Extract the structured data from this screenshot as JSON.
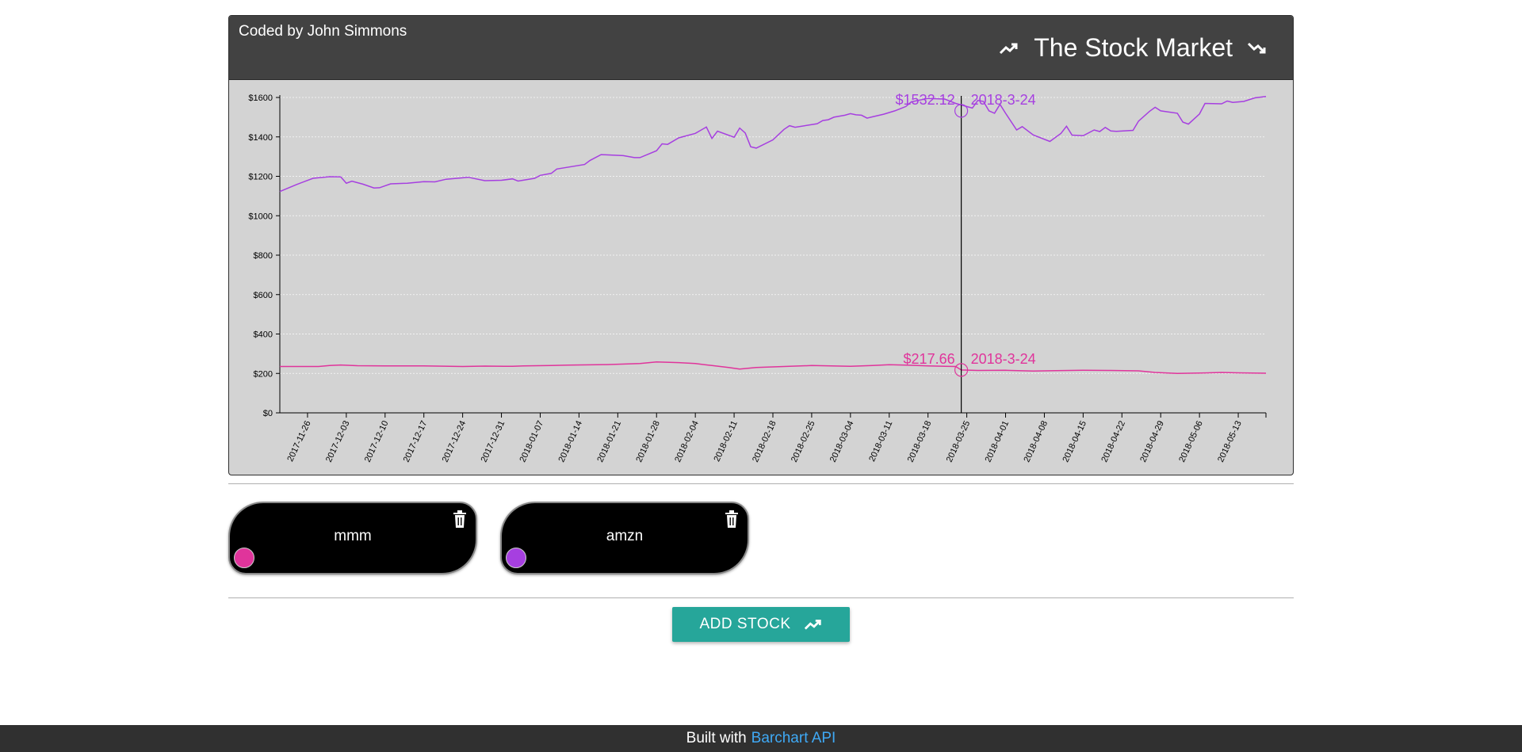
{
  "header": {
    "credit": "Coded by John Simmons",
    "title": "The Stock Market",
    "icon_left": "trending-up-icon",
    "icon_right": "trending-down-icon"
  },
  "colors": {
    "amzn": "#a63fe0",
    "mmm": "#e0349b",
    "header_bg": "#424242",
    "chart_bg": "#d3d3d3",
    "button": "#26a69a",
    "link": "#3fa9f5"
  },
  "stocks": [
    {
      "symbol": "mmm",
      "color": "#e0349b"
    },
    {
      "symbol": "amzn",
      "color": "#a63fe0"
    }
  ],
  "button": {
    "label": "ADD STOCK",
    "icon": "trending-up-icon"
  },
  "footer": {
    "prefix": "Built with",
    "link": "Barchart API"
  },
  "chart_data": {
    "type": "line",
    "title": "",
    "xlabel": "",
    "ylabel": "",
    "x_start": "2017-11-21",
    "x_end": "2018-05-18",
    "ylim": [
      0,
      1600
    ],
    "yticks": [
      {
        "value": 0,
        "label": "$0"
      },
      {
        "value": 200,
        "label": "$200"
      },
      {
        "value": 400,
        "label": "$400"
      },
      {
        "value": 600,
        "label": "$600"
      },
      {
        "value": 800,
        "label": "$800"
      },
      {
        "value": 1000,
        "label": "$1000"
      },
      {
        "value": 1200,
        "label": "$1200"
      },
      {
        "value": 1400,
        "label": "$1400"
      },
      {
        "value": 1600,
        "label": "$1600"
      }
    ],
    "xticks": [
      "2017-11-26",
      "2017-12-03",
      "2017-12-10",
      "2017-12-17",
      "2017-12-24",
      "2017-12-31",
      "2018-01-07",
      "2018-01-14",
      "2018-01-21",
      "2018-01-28",
      "2018-02-04",
      "2018-02-11",
      "2018-02-18",
      "2018-02-25",
      "2018-03-04",
      "2018-03-11",
      "2018-03-18",
      "2018-03-25",
      "2018-04-01",
      "2018-04-08",
      "2018-04-15",
      "2018-04-22",
      "2018-04-29",
      "2018-05-06",
      "2018-05-13"
    ],
    "grid": true,
    "series": [
      {
        "name": "amzn",
        "color": "#a63fe0",
        "points": [
          [
            "2017-11-21",
            1123
          ],
          [
            "2017-11-24",
            1158
          ],
          [
            "2017-11-27",
            1190
          ],
          [
            "2017-11-30",
            1198
          ],
          [
            "2017-12-02",
            1197
          ],
          [
            "2017-12-03",
            1165
          ],
          [
            "2017-12-04",
            1175
          ],
          [
            "2017-12-06",
            1160
          ],
          [
            "2017-12-08",
            1141
          ],
          [
            "2017-12-09",
            1142
          ],
          [
            "2017-12-11",
            1162
          ],
          [
            "2017-12-14",
            1165
          ],
          [
            "2017-12-17",
            1173
          ],
          [
            "2017-12-19",
            1172
          ],
          [
            "2017-12-21",
            1185
          ],
          [
            "2017-12-25",
            1195
          ],
          [
            "2017-12-28",
            1178
          ],
          [
            "2017-12-31",
            1180
          ],
          [
            "2018-01-02",
            1187
          ],
          [
            "2018-01-03",
            1176
          ],
          [
            "2018-01-06",
            1190
          ],
          [
            "2018-01-07",
            1205
          ],
          [
            "2018-01-09",
            1215
          ],
          [
            "2018-01-10",
            1237
          ],
          [
            "2018-01-15",
            1260
          ],
          [
            "2018-01-16",
            1281
          ],
          [
            "2018-01-18",
            1310
          ],
          [
            "2018-01-22",
            1305
          ],
          [
            "2018-01-24",
            1295
          ],
          [
            "2018-01-25",
            1295
          ],
          [
            "2018-01-28",
            1330
          ],
          [
            "2018-01-29",
            1365
          ],
          [
            "2018-01-30",
            1362
          ],
          [
            "2018-02-01",
            1395
          ],
          [
            "2018-02-04",
            1418
          ],
          [
            "2018-02-06",
            1450
          ],
          [
            "2018-02-07",
            1392
          ],
          [
            "2018-02-08",
            1429
          ],
          [
            "2018-02-11",
            1398
          ],
          [
            "2018-02-12",
            1445
          ],
          [
            "2018-02-13",
            1420
          ],
          [
            "2018-02-14",
            1350
          ],
          [
            "2018-02-15",
            1343
          ],
          [
            "2018-02-18",
            1385
          ],
          [
            "2018-02-20",
            1438
          ],
          [
            "2018-02-21",
            1457
          ],
          [
            "2018-02-22",
            1449
          ],
          [
            "2018-02-26",
            1467
          ],
          [
            "2018-02-27",
            1483
          ],
          [
            "2018-02-28",
            1487
          ],
          [
            "2018-03-01",
            1500
          ],
          [
            "2018-03-03",
            1510
          ],
          [
            "2018-03-04",
            1518
          ],
          [
            "2018-03-05",
            1512
          ],
          [
            "2018-03-06",
            1510
          ],
          [
            "2018-03-07",
            1495
          ],
          [
            "2018-03-08",
            1502
          ],
          [
            "2018-03-10",
            1515
          ],
          [
            "2018-03-12",
            1532
          ],
          [
            "2018-03-13",
            1543
          ],
          [
            "2018-03-14",
            1554
          ],
          [
            "2018-03-15",
            1578
          ],
          [
            "2018-03-18",
            1595
          ],
          [
            "2018-03-21",
            1592
          ],
          [
            "2018-03-23",
            1570
          ],
          [
            "2018-03-26",
            1546
          ],
          [
            "2018-03-27",
            1585
          ],
          [
            "2018-03-28",
            1580
          ],
          [
            "2018-03-29",
            1532
          ],
          [
            "2018-03-30",
            1520
          ],
          [
            "2018-03-31",
            1565
          ],
          [
            "2018-04-01",
            1520
          ],
          [
            "2018-04-03",
            1435
          ],
          [
            "2018-04-04",
            1452
          ],
          [
            "2018-04-06",
            1410
          ],
          [
            "2018-04-09",
            1377
          ],
          [
            "2018-04-11",
            1418
          ],
          [
            "2018-04-12",
            1454
          ],
          [
            "2018-04-13",
            1409
          ],
          [
            "2018-04-15",
            1406
          ],
          [
            "2018-04-17",
            1435
          ],
          [
            "2018-04-18",
            1427
          ],
          [
            "2018-04-19",
            1448
          ],
          [
            "2018-04-20",
            1430
          ],
          [
            "2018-04-21",
            1428
          ],
          [
            "2018-04-24",
            1433
          ],
          [
            "2018-04-25",
            1480
          ],
          [
            "2018-04-27",
            1530
          ],
          [
            "2018-04-28",
            1550
          ],
          [
            "2018-04-29",
            1532
          ],
          [
            "2018-05-02",
            1520
          ],
          [
            "2018-05-03",
            1475
          ],
          [
            "2018-05-04",
            1465
          ],
          [
            "2018-05-06",
            1516
          ],
          [
            "2018-05-07",
            1570
          ],
          [
            "2018-05-10",
            1568
          ],
          [
            "2018-05-11",
            1582
          ],
          [
            "2018-05-12",
            1575
          ],
          [
            "2018-05-14",
            1580
          ],
          [
            "2018-05-16",
            1598
          ],
          [
            "2018-05-18",
            1605
          ]
        ],
        "annotation": {
          "value": "$1532.12",
          "date": "2018-3-24"
        }
      },
      {
        "name": "mmm",
        "color": "#e0349b",
        "points": [
          [
            "2017-11-21",
            235
          ],
          [
            "2017-11-28",
            235
          ],
          [
            "2017-11-30",
            240
          ],
          [
            "2017-12-02",
            243
          ],
          [
            "2017-12-05",
            239
          ],
          [
            "2017-12-10",
            238
          ],
          [
            "2017-12-17",
            238
          ],
          [
            "2017-12-24",
            235
          ],
          [
            "2017-12-28",
            237
          ],
          [
            "2018-01-02",
            236
          ],
          [
            "2018-01-04",
            238
          ],
          [
            "2018-01-09",
            240
          ],
          [
            "2018-01-12",
            242
          ],
          [
            "2018-01-19",
            245
          ],
          [
            "2018-01-25",
            250
          ],
          [
            "2018-01-28",
            258
          ],
          [
            "2018-02-01",
            255
          ],
          [
            "2018-02-04",
            250
          ],
          [
            "2018-02-07",
            240
          ],
          [
            "2018-02-10",
            230
          ],
          [
            "2018-02-12",
            222
          ],
          [
            "2018-02-15",
            230
          ],
          [
            "2018-02-20",
            235
          ],
          [
            "2018-02-25",
            240
          ],
          [
            "2018-03-04",
            236
          ],
          [
            "2018-03-08",
            240
          ],
          [
            "2018-03-11",
            244
          ],
          [
            "2018-03-14",
            242
          ],
          [
            "2018-03-18",
            238
          ],
          [
            "2018-03-21",
            236
          ],
          [
            "2018-03-23",
            235
          ],
          [
            "2018-03-24",
            217.66
          ],
          [
            "2018-03-27",
            215
          ],
          [
            "2018-04-01",
            216
          ],
          [
            "2018-04-06",
            212
          ],
          [
            "2018-04-10",
            214
          ],
          [
            "2018-04-15",
            216
          ],
          [
            "2018-04-20",
            215
          ],
          [
            "2018-04-25",
            213
          ],
          [
            "2018-04-28",
            205
          ],
          [
            "2018-05-02",
            200
          ],
          [
            "2018-05-06",
            202
          ],
          [
            "2018-05-10",
            205
          ],
          [
            "2018-05-13",
            203
          ],
          [
            "2018-05-18",
            201
          ]
        ],
        "annotation": {
          "value": "$217.66",
          "date": "2018-3-24"
        }
      }
    ],
    "crosshair_date": "2018-3-24"
  }
}
